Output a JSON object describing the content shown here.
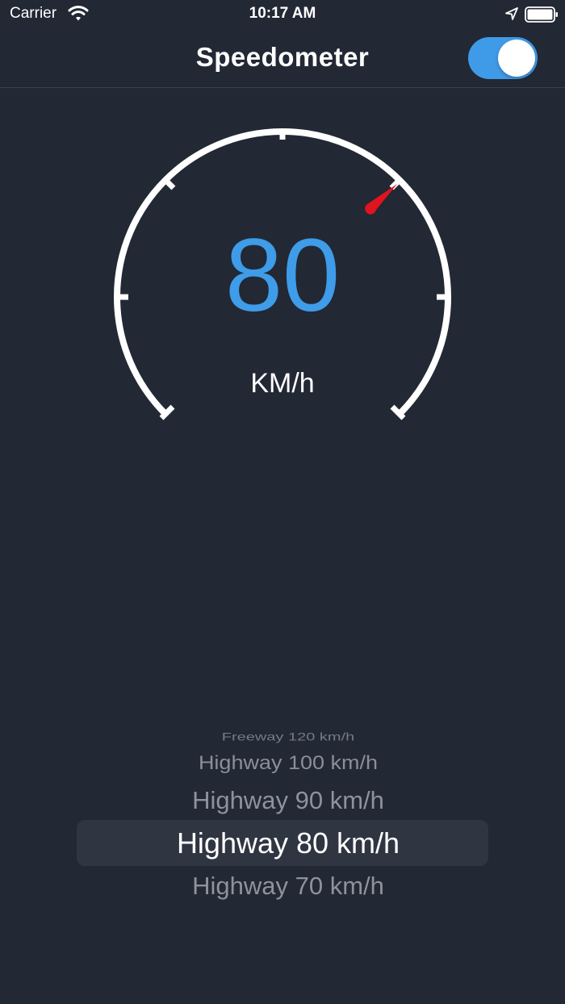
{
  "status_bar": {
    "carrier": "Carrier",
    "time": "10:17 AM"
  },
  "nav": {
    "title": "Speedometer",
    "toggle_on": true,
    "toggle_color": "#3f9be8"
  },
  "gauge": {
    "speed": "80",
    "unit": "KM/h",
    "speed_color": "#3e9ce8",
    "needle_color": "#e0141e"
  },
  "picker": {
    "selected_index": 3,
    "items": [
      "Freeway 120 km/h",
      "Highway 100 km/h",
      "Highway 90 km/h",
      "Highway 80 km/h",
      "Highway 70 km/h"
    ]
  },
  "icons": {
    "wifi": "wifi-icon",
    "location": "location-arrow-icon",
    "battery": "battery-full-icon"
  }
}
